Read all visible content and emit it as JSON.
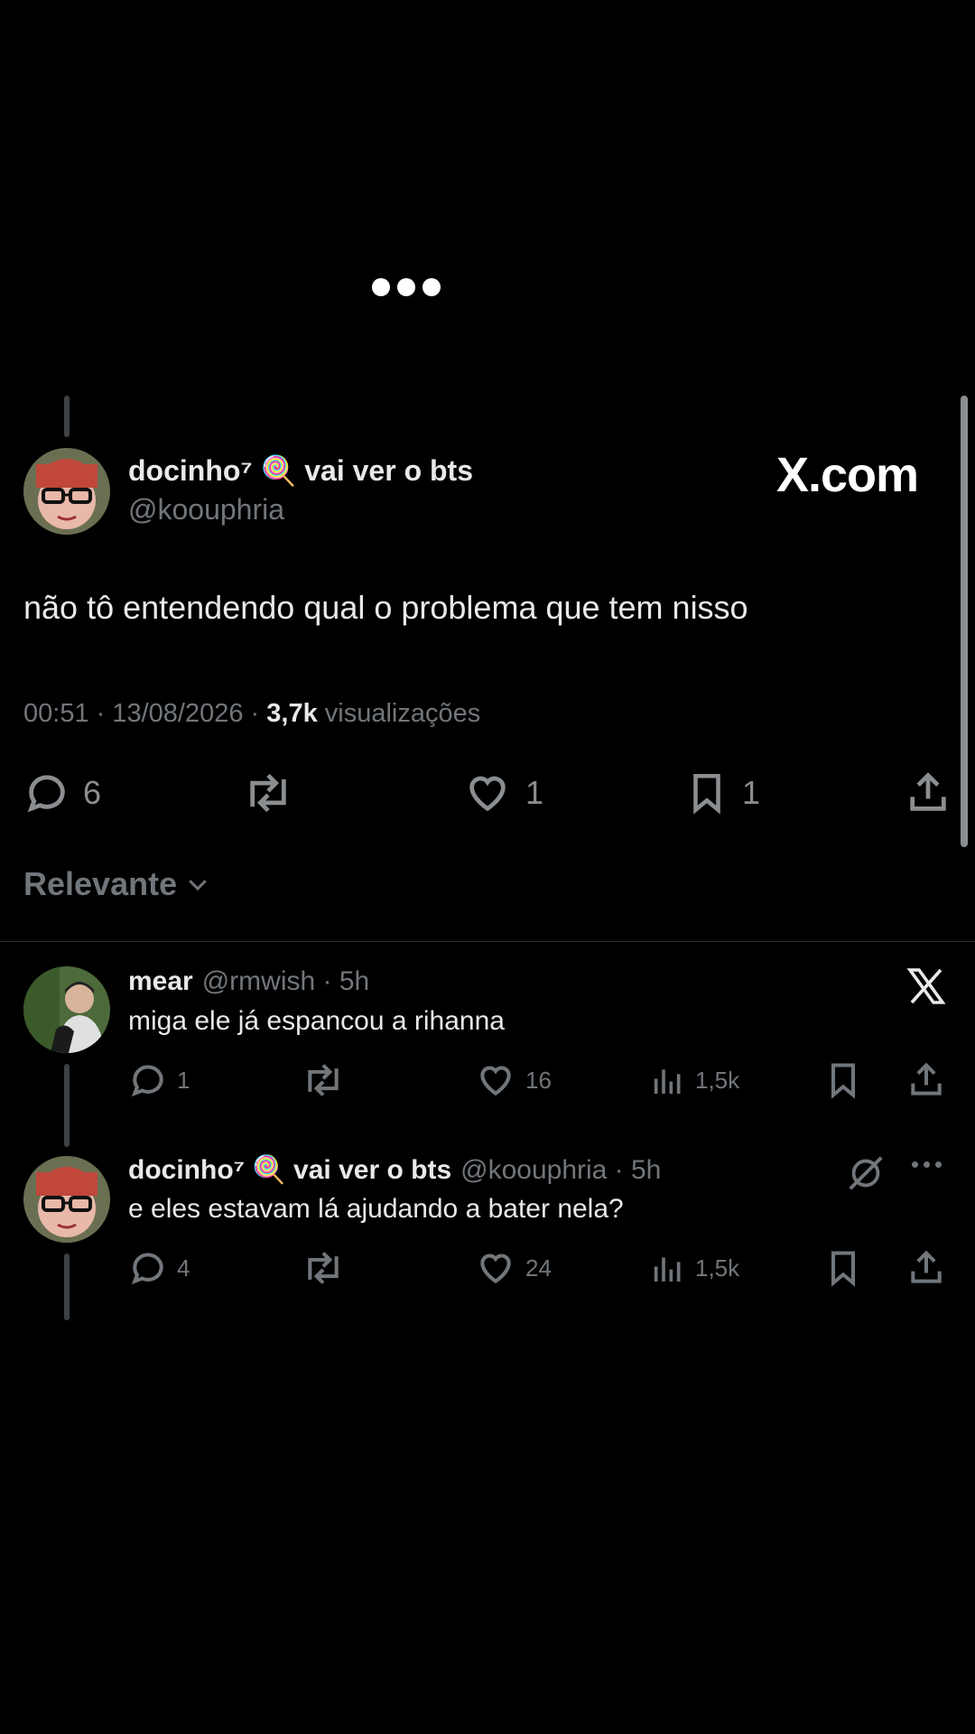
{
  "main_tweet": {
    "display_name": "docinho⁷ 🍭 vai ver o bts",
    "handle": "@koouphria",
    "brand": "X.com",
    "text": "não tô entendendo qual o problema que tem nisso",
    "time_date": "00:51 · 13/08/2026 · ",
    "views_count": "3,7k",
    "views_label": " visualizações",
    "actions": {
      "replies": "6",
      "reposts": "",
      "likes": "1",
      "bookmarks": "1"
    }
  },
  "sort": {
    "label": "Relevante"
  },
  "replies": [
    {
      "display_name": "mear",
      "handle": "@rmwish · 5h",
      "text": "miga ele já espancou a rihanna",
      "actions": {
        "replies": "1",
        "likes": "16",
        "views": "1,5k"
      }
    },
    {
      "display_name": "docinho⁷ 🍭 vai ver o bts",
      "handle": "@koouphria · 5h",
      "text": "e eles estavam lá ajudando a bater nela?",
      "actions": {
        "replies": "4",
        "likes": "24",
        "views": "1,5k"
      }
    }
  ],
  "icons": [
    "more-dots-icon",
    "reply-icon",
    "repost-icon",
    "like-icon",
    "bookmark-icon",
    "share-icon",
    "views-icon",
    "x-logo-icon",
    "grok-icon",
    "chevron-down-icon"
  ],
  "colors": {
    "background": "#000000",
    "text": "#e7e9ea",
    "muted": "#71767b",
    "divider": "#2f3336"
  }
}
